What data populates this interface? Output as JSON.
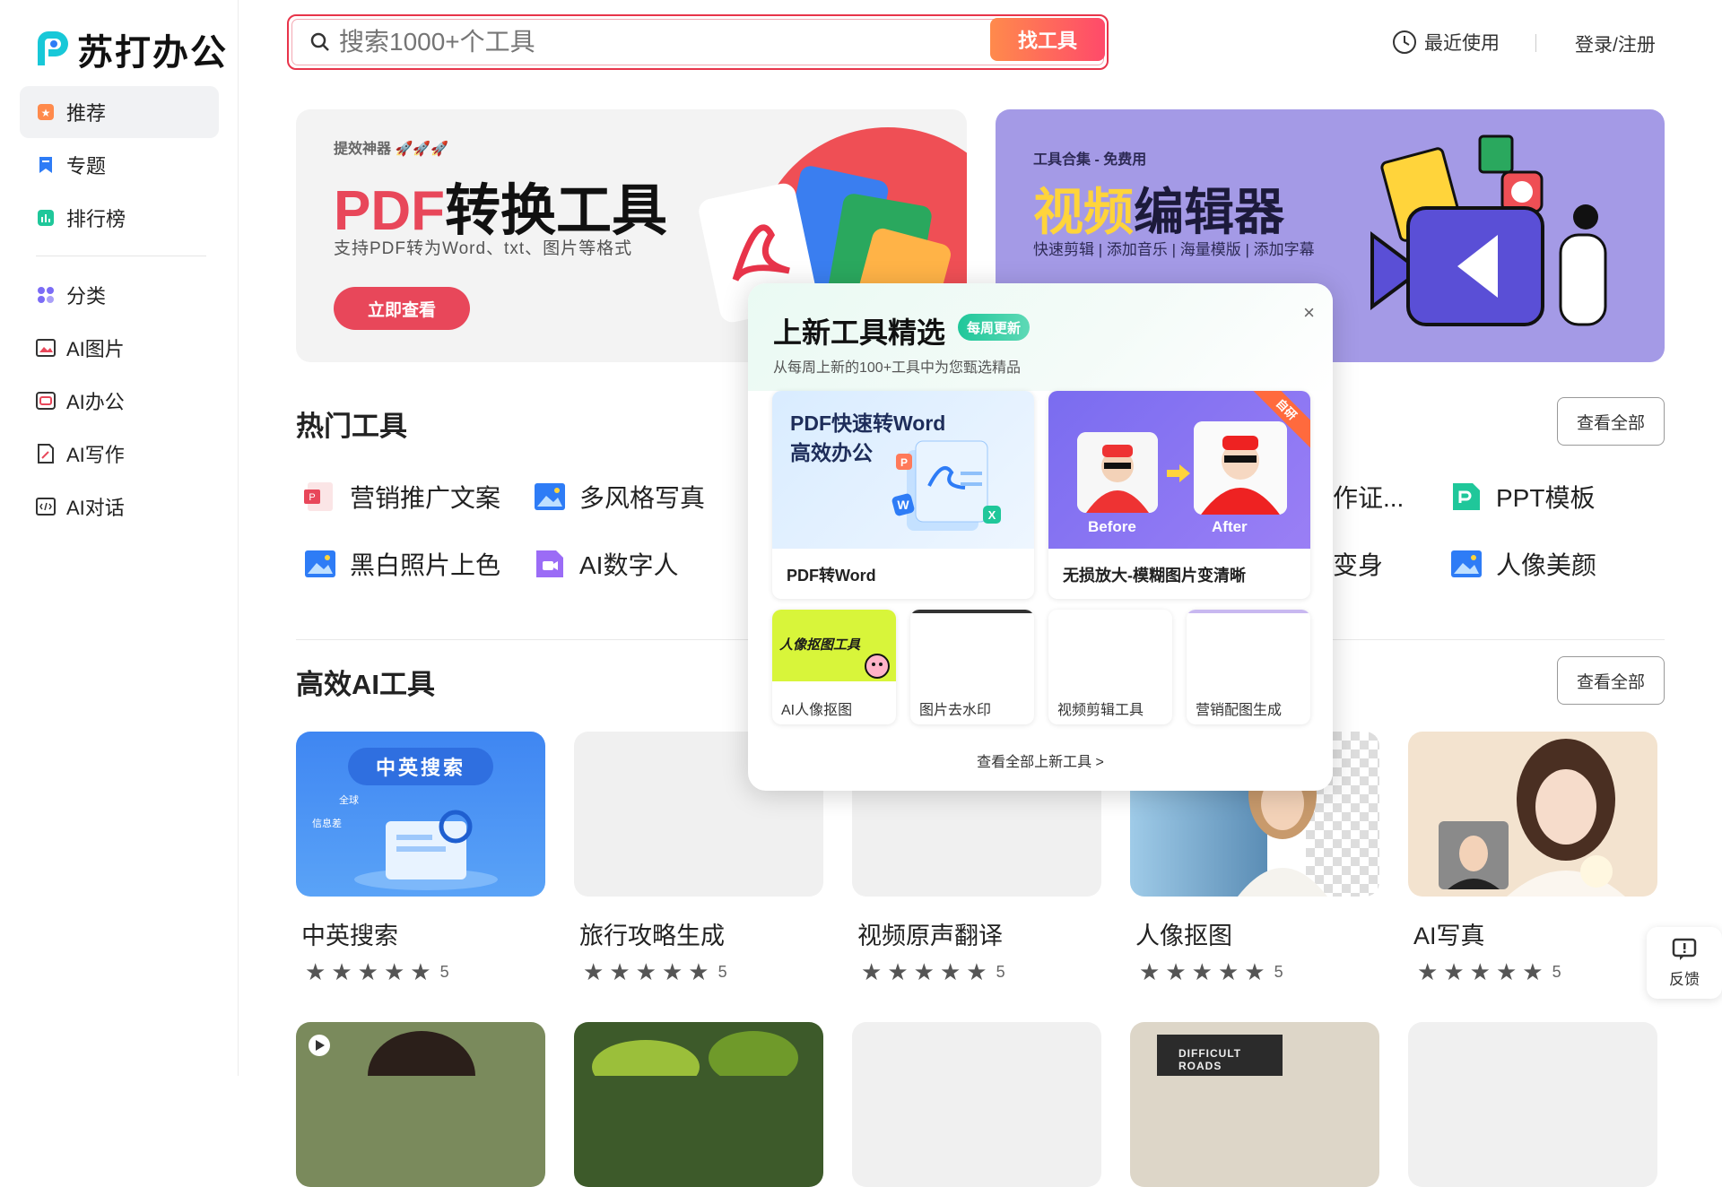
{
  "brand": {
    "name": "苏打办公"
  },
  "sidebar": {
    "items": [
      {
        "label": "推荐",
        "icon": "star-icon"
      },
      {
        "label": "专题",
        "icon": "bookmark-icon"
      },
      {
        "label": "排行榜",
        "icon": "chart-icon"
      },
      {
        "label": "分类",
        "icon": "grid-icon"
      },
      {
        "label": "AI图片",
        "icon": "image-icon"
      },
      {
        "label": "AI办公",
        "icon": "office-icon"
      },
      {
        "label": "AI写作",
        "icon": "write-icon"
      },
      {
        "label": "AI对话",
        "icon": "chat-icon"
      }
    ]
  },
  "search": {
    "placeholder": "搜索1000+个工具",
    "button": "找工具"
  },
  "header": {
    "recent": "最近使用",
    "login": "登录/注册"
  },
  "banners": [
    {
      "tag": "提效神器 🚀🚀🚀",
      "title_a": "PDF",
      "title_b": "转换工具",
      "subtitle": "支持PDF转为Word、txt、图片等格式",
      "button": "立即查看"
    },
    {
      "tag": "工具合集 - 免费用",
      "title_a": "视频",
      "title_b": "编辑器",
      "subtitle": "快速剪辑 | 添加音乐 | 海量模版 | 添加字幕"
    }
  ],
  "hot_tools": {
    "title": "热门工具",
    "view_all": "查看全部",
    "items": [
      "营销推广文案",
      "多风格写真",
      "作证...",
      "PPT模板",
      "黑白照片上色",
      "AI数字人",
      "变身",
      "人像美颜"
    ]
  },
  "ai_tools": {
    "title": "高效AI工具",
    "view_all": "查看全部",
    "cards": [
      {
        "name": "中英搜索",
        "rating": "5",
        "thumb_text": "中英搜索",
        "thumb_small_1": "全球",
        "thumb_small_2": "信息差"
      },
      {
        "name": "旅行攻略生成",
        "rating": "5"
      },
      {
        "name": "视频原声翻译",
        "rating": "5"
      },
      {
        "name": "人像抠图",
        "rating": "5"
      },
      {
        "name": "AI写真",
        "rating": "5"
      }
    ],
    "row2_text": "DIFFICULT ROADS"
  },
  "popup": {
    "title": "上新工具精选",
    "badge": "每周更新",
    "subtitle": "从每周上新的100+工具中为您甄选精品",
    "close": "×",
    "big_cards": [
      {
        "label": "PDF转Word",
        "headline_1": "PDF快速转Word",
        "headline_2": "高效办公",
        "p_letter": "P",
        "w_letter": "W",
        "x_letter": "X"
      },
      {
        "label": "无损放大-模糊图片变清晰",
        "before": "Before",
        "after": "After",
        "corner": "自研"
      }
    ],
    "small_cards": [
      {
        "label": "AI人像抠图",
        "thumb_text": "人像抠图工具"
      },
      {
        "label": "图片去水印"
      },
      {
        "label": "视频剪辑工具"
      },
      {
        "label": "营销配图生成"
      }
    ],
    "view_all": "查看全部上新工具 >"
  },
  "feedback": {
    "label": "反馈"
  },
  "colors": {
    "accent": "#e8344a",
    "brand_blue": "#2e7cf6",
    "brand_green": "#1fc79a",
    "banner_purple": "#a49ae6"
  }
}
